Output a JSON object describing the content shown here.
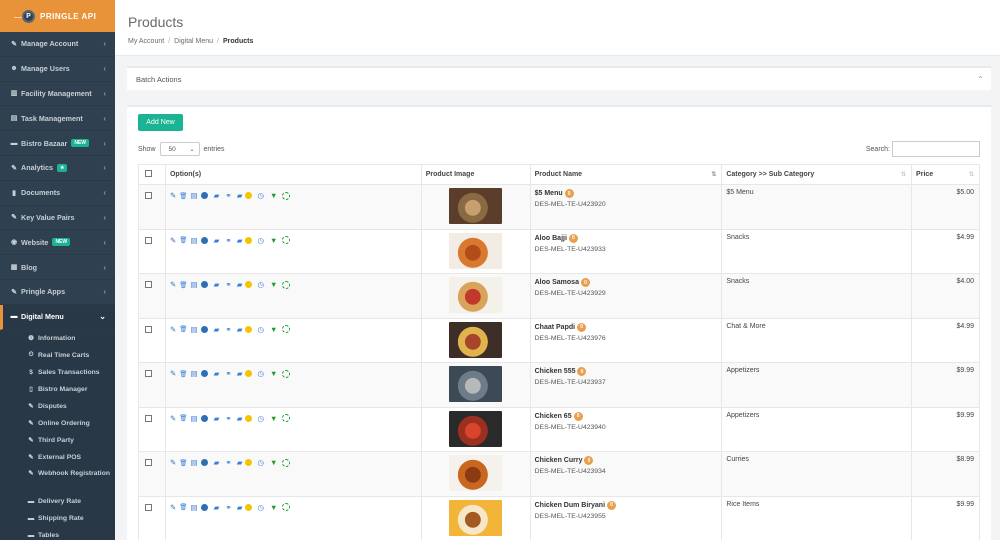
{
  "brand": {
    "name": "PRINGLE API",
    "logo_letter": "P"
  },
  "sidebar": {
    "items": [
      {
        "label": "Manage Account",
        "icon": "wrench-icon",
        "glyph": "✎",
        "chev": "‹"
      },
      {
        "label": "Manage Users",
        "icon": "users-icon",
        "glyph": "☻",
        "chev": "‹"
      },
      {
        "label": "Facility Management",
        "icon": "building-icon",
        "glyph": "▥",
        "chev": "‹"
      },
      {
        "label": "Task Management",
        "icon": "tasks-icon",
        "glyph": "▤",
        "chev": "‹"
      },
      {
        "label": "Bistro Bazaar",
        "icon": "cart-icon",
        "glyph": "▬",
        "badge": "NEW",
        "chev": "‹"
      },
      {
        "label": "Analytics",
        "icon": "chart-icon",
        "glyph": "✎",
        "badge": "★",
        "chev": "‹"
      },
      {
        "label": "Documents",
        "icon": "file-icon",
        "glyph": "▮",
        "chev": "‹"
      },
      {
        "label": "Key Value Pairs",
        "icon": "key-icon",
        "glyph": "✎",
        "chev": "‹"
      },
      {
        "label": "Website",
        "icon": "globe-icon",
        "glyph": "◉",
        "badge": "NEW",
        "chev": "‹"
      },
      {
        "label": "Blog",
        "icon": "blog-icon",
        "glyph": "▦",
        "chev": "‹"
      },
      {
        "label": "Pringle Apps",
        "icon": "apps-icon",
        "glyph": "✎",
        "chev": "‹"
      }
    ],
    "active": {
      "label": "Digital Menu",
      "icon": "cart-icon",
      "glyph": "▬",
      "chev": "⌄"
    },
    "subitems": [
      {
        "label": "Information",
        "glyph": "❶"
      },
      {
        "label": "Real Time Carts",
        "glyph": "⏲"
      },
      {
        "label": "Sales Transactions",
        "glyph": "$"
      },
      {
        "label": "Bistro Manager",
        "glyph": "▯"
      },
      {
        "label": "Disputes",
        "glyph": "✎"
      },
      {
        "label": "Online Ordering",
        "glyph": "✎"
      },
      {
        "label": "Third Party",
        "glyph": "✎"
      },
      {
        "label": "External POS",
        "glyph": "✎"
      },
      {
        "label": "Webhook Registration",
        "glyph": "✎"
      },
      {
        "label": "Delivery Rate",
        "glyph": "▬"
      },
      {
        "label": "Shipping Rate",
        "glyph": "▬"
      },
      {
        "label": "Tables",
        "glyph": "▬"
      }
    ]
  },
  "page": {
    "title": "Products",
    "breadcrumb": [
      "My Account",
      "Digital Menu",
      "Products"
    ],
    "breadcrumb_sep": "/"
  },
  "batch": {
    "label": "Batch Actions",
    "toggle": "⌃"
  },
  "toolbar": {
    "add_label": "Add New",
    "show_label": "Show",
    "entries_value": "50",
    "entries_label": "entries",
    "search_label": "Search:",
    "search_value": "",
    "dropdown": "⌄"
  },
  "table": {
    "headers": [
      "Option(s)",
      "Product Image",
      "Product Name",
      "Category >> Sub Category",
      "Price"
    ],
    "sort_glyph": "⇅",
    "option_glyphs": {
      "edit": "✎",
      "delete": "🗑",
      "copy": "▤",
      "folder": "▰",
      "link": "⚭",
      "truck": "▰",
      "clock": "◷",
      "cart": "▼"
    },
    "rows": [
      {
        "name": "$5 Menu",
        "count": "0",
        "sku": "DES-MEL-TE-U423920",
        "category": "$5 Menu",
        "price": "$5.00",
        "img": [
          "#5a3e2b",
          "#8a6a43",
          "#c8a070"
        ]
      },
      {
        "name": "Aloo Bajji",
        "count": "0",
        "sku": "DES-MEL-TE-U423933",
        "category": "Snacks",
        "price": "$4.99",
        "img": [
          "#f2ece4",
          "#d9782f",
          "#b24d1a"
        ]
      },
      {
        "name": "Aloo Samosa",
        "count": "0",
        "sku": "DES-MEL-TE-U423929",
        "category": "Snacks",
        "price": "$4.00",
        "img": [
          "#f4f0ea",
          "#d9a45a",
          "#c0392b"
        ]
      },
      {
        "name": "Chaat Papdi",
        "count": "0",
        "sku": "DES-MEL-TE-U423976",
        "category": "Chat & More",
        "price": "$4.99",
        "img": [
          "#3d2f28",
          "#e0b34d",
          "#a7452a"
        ]
      },
      {
        "name": "Chicken 555",
        "count": "0",
        "sku": "DES-MEL-TE-U423937",
        "category": "Appetizers",
        "price": "$9.99",
        "img": [
          "#3c4a55",
          "#6d7c88",
          "#b6b9b8"
        ]
      },
      {
        "name": "Chicken 65",
        "count": "0",
        "sku": "DES-MEL-TE-U423940",
        "category": "Appetizers",
        "price": "$9.99",
        "img": [
          "#2b2a2a",
          "#9c2f1f",
          "#d8452a"
        ]
      },
      {
        "name": "Chicken Curry",
        "count": "0",
        "sku": "DES-MEL-TE-U423934",
        "category": "Curries",
        "price": "$8.99",
        "img": [
          "#f5f2ee",
          "#c9661f",
          "#8a3b12"
        ]
      },
      {
        "name": "Chicken Dum Biryani",
        "count": "0",
        "sku": "DES-MEL-TE-U423955",
        "category": "Rice Items",
        "price": "$9.99",
        "img": [
          "#f2b53a",
          "#f6e7c8",
          "#a35a23"
        ]
      }
    ]
  }
}
